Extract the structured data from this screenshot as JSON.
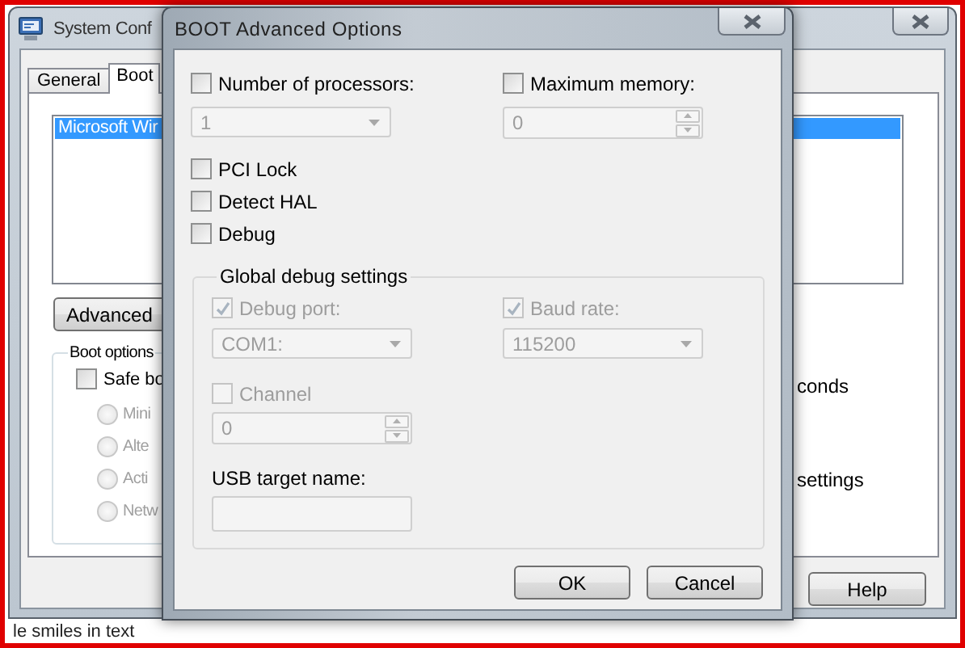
{
  "system_configuration": {
    "title": "System Conf",
    "tabs": [
      {
        "label": "General",
        "selected": false
      },
      {
        "label": "Boot",
        "selected": true
      }
    ],
    "boot_entries": [
      {
        "label": "Microsoft Wir",
        "selected": true
      }
    ],
    "advanced_button": "Advanced",
    "boot_options": {
      "title": "Boot options",
      "safe_boot": {
        "label": "Safe bo",
        "checked": false
      },
      "modes": [
        {
          "label": "Mini",
          "selected": false,
          "disabled": true
        },
        {
          "label": "Alte",
          "selected": false,
          "disabled": true
        },
        {
          "label": "Acti",
          "selected": false,
          "disabled": true
        },
        {
          "label": "Netw",
          "selected": false,
          "disabled": true
        }
      ]
    },
    "timeout_unit": "conds",
    "settings_text": "settings",
    "help_button": "Help"
  },
  "boot_advanced_options": {
    "title": "BOOT Advanced Options",
    "processors": {
      "label": "Number of processors:",
      "checked": false,
      "value": "1",
      "disabled": true
    },
    "max_memory": {
      "label": "Maximum memory:",
      "checked": false,
      "value": "0",
      "disabled": true
    },
    "flags": [
      {
        "label": "PCI Lock",
        "checked": false
      },
      {
        "label": "Detect HAL",
        "checked": false
      },
      {
        "label": "Debug",
        "checked": false
      }
    ],
    "debug_settings": {
      "title": "Global debug settings",
      "debug_port": {
        "label": "Debug port:",
        "checked": true,
        "disabled": true,
        "value": "COM1:"
      },
      "baud_rate": {
        "label": "Baud rate:",
        "checked": true,
        "disabled": true,
        "value": "115200"
      },
      "channel": {
        "label": "Channel",
        "checked": false,
        "disabled": true,
        "value": "0"
      },
      "usb_target": {
        "label": "USB target name:",
        "disabled": true
      }
    },
    "buttons": [
      {
        "label": "OK"
      },
      {
        "label": "Cancel"
      }
    ]
  },
  "desktop_text": "le smiles in text"
}
